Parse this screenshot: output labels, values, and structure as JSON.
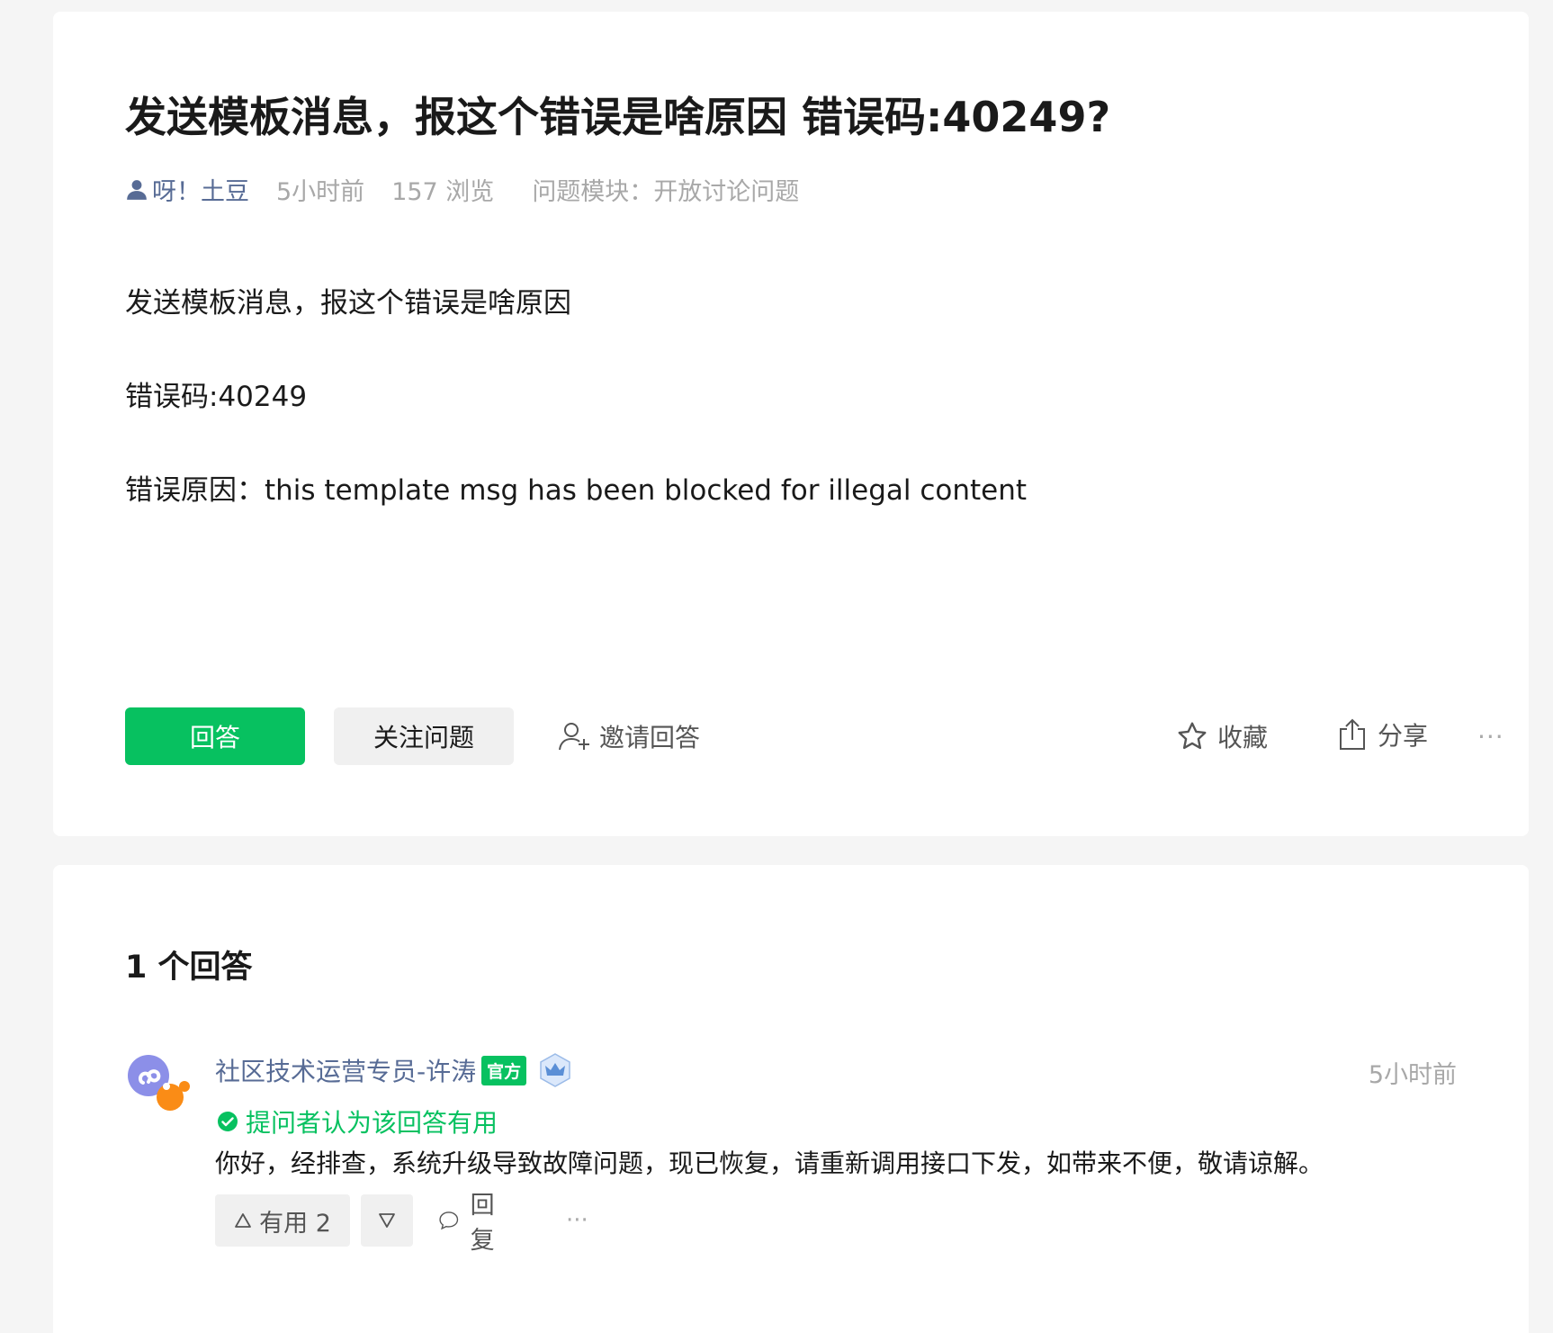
{
  "question": {
    "title": "发送模板消息，报这个错误是啥原因 错误码:40249?",
    "author": "呀！土豆",
    "time": "5小时前",
    "views": "157 浏览",
    "module_label": "问题模块：",
    "module_value": "开放讨论问题",
    "paragraphs": [
      "发送模板消息，报这个错误是啥原因",
      "错误码:40249",
      "错误原因：this template msg has been blocked for illegal content"
    ],
    "actions": {
      "answer": "回答",
      "follow": "关注问题",
      "invite": "邀请回答",
      "favorite": "收藏",
      "share": "分享",
      "more": "···"
    }
  },
  "answers": {
    "count_label": "1 个回答",
    "items": [
      {
        "author": "社区技术运营专员-许涛",
        "badge": "官方",
        "time": "5小时前",
        "accepted": "提问者认为该回答有用",
        "content": "你好，经排查，系统升级导致故障问题，现已恢复，请重新调用接口下发，如带来不便，敬请谅解。",
        "useful": "有用 2",
        "reply": "回复",
        "more": "···"
      }
    ]
  },
  "colors": {
    "accent_green": "#07c160",
    "link_blue": "#576b95",
    "muted": "#a8a8a8"
  }
}
